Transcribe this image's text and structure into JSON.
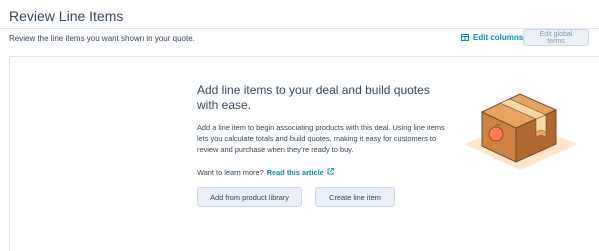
{
  "header": {
    "title": "Review Line Items",
    "subtitle": "Review the line items you want shown in your quote.",
    "edit_columns_label": "Edit columns",
    "edit_global_terms_label": "Edit global terms"
  },
  "empty_state": {
    "title": "Add line items to your deal and build quotes with ease.",
    "body": "Add a line item to begin associating products with this deal. Using line items lets you calculate totals and build quotes, making it easy for customers to review and purchase when they’re ready to buy.",
    "learn_more_prefix": "Want to learn more?",
    "learn_more_link": "Read this article",
    "add_from_library_label": "Add from product library",
    "create_line_item_label": "Create line item"
  },
  "colors": {
    "link": "#0091ae",
    "text": "#33475b",
    "button_bg": "#eaf0f6",
    "border": "#dfe3eb"
  },
  "icons": {
    "edit_columns": "columns-icon",
    "external_link": "external-link-icon",
    "illustration": "package-box-icon"
  }
}
